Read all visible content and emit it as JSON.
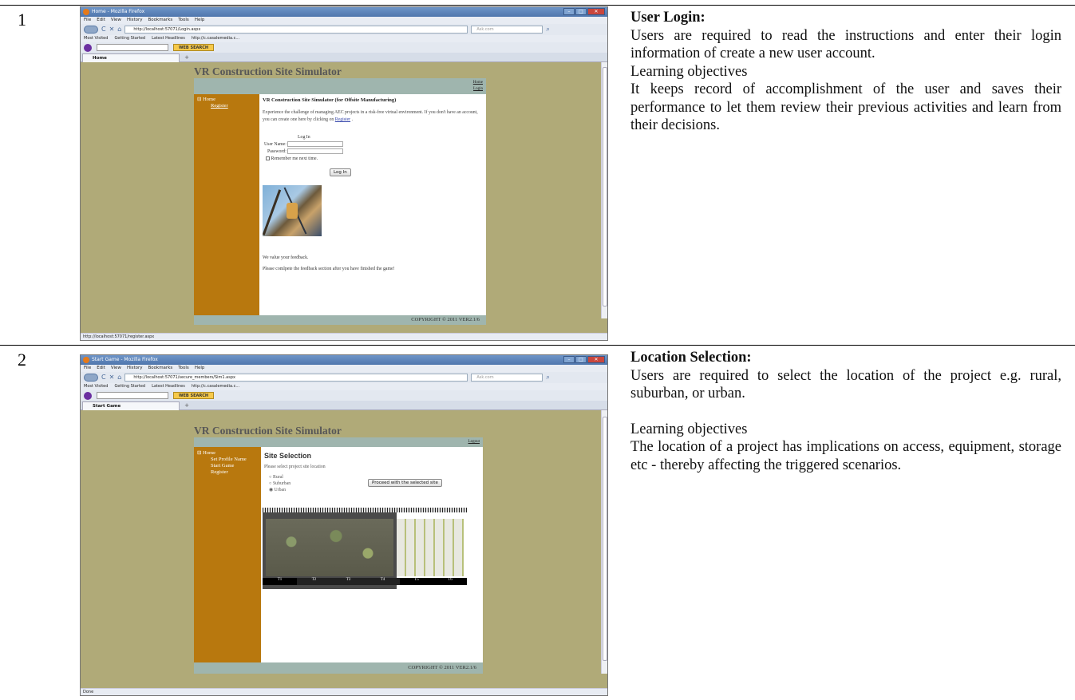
{
  "rows": [
    {
      "number": "1",
      "heading": "User Login:",
      "text1": "Users are required to read the instructions and enter their login information of create a new user account.",
      "lo_heading": "Learning objectives",
      "text2": "It keeps record of accomplishment of the user and saves their performance to let them review their previous activities and learn from their decisions.",
      "browser": {
        "window_title": "Home - Mozilla Firefox",
        "url": "http://localhost:57071/Login.aspx",
        "tab": "Home",
        "status": "http://localhost:57071/register.aspx"
      },
      "site": {
        "title": "VR Construction Site Simulator",
        "bar_links": [
          "Home",
          "Login"
        ],
        "side": [
          "⊟ Home",
          "Register"
        ],
        "heading": "VR Construction Site Simulator (for Offsite Manufacturing)",
        "intro": "Experience the challenge of managing AEC projects in a risk-free virtual environment. If you don't have an account, you can create one here by clicking on",
        "intro_link": "Register",
        "intro_end": ".",
        "login_title": "Log In",
        "username_label": "User Name:",
        "password_label": "Password:",
        "remember": "Remember me next time.",
        "login_button": "Log In",
        "feedback1": "We value your feedback.",
        "feedback2": "Please comlpete the feedback section after you have finished the game!",
        "footer": "COPYRIGHT © 2011 VER2.1/6"
      }
    },
    {
      "number": "2",
      "heading": "Location Selection:",
      "text1": "Users are required to select the location of the project e.g. rural, suburban, or urban.",
      "lo_heading": "Learning objectives",
      "text2": "The location of a project has implications on access, equipment, storage etc - thereby affecting the triggered scenarios.",
      "browser": {
        "window_title": "Start Game - Mozilla Firefox",
        "url": "http://localhost:57071/secure_members/Sim1.aspx",
        "tab": "Start Game",
        "status": "Done"
      },
      "site": {
        "title": "VR Construction Site Simulator",
        "bar_links": [
          "Logout"
        ],
        "side": [
          "⊟ Home",
          "Set Profile Name",
          "Start Game",
          "Register"
        ],
        "heading": "Site Selection",
        "prompt": "Please select project site location",
        "options": [
          "Rural",
          "Suburban",
          "Urban"
        ],
        "selected": "Urban",
        "proceed_button": "Proceed with the selected site",
        "transect_labels": [
          "T1",
          "T2",
          "T3",
          "T4",
          "T5",
          "T6"
        ],
        "footer": "COPYRIGHT © 2011 VER2.1/6"
      }
    }
  ],
  "browser_common": {
    "menu": [
      "File",
      "Edit",
      "View",
      "History",
      "Bookmarks",
      "Tools",
      "Help"
    ],
    "bookmarks": [
      "Most Visited",
      "Getting Started",
      "Latest Headlines",
      "http://c.casalemedia.c..."
    ],
    "ask_placeholder": "Ask.com",
    "web_search": "WEB SEARCH"
  }
}
